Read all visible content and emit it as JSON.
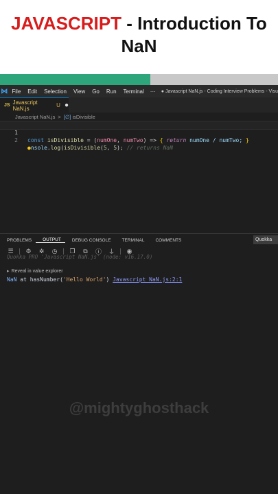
{
  "header": {
    "title_accent": "JAVASCRIPT",
    "title_rest": " - Introduction To",
    "title_line2": "NaN"
  },
  "progress": {
    "fraction": 0.54,
    "fill_color": "#2ea57a",
    "track_color": "#c8c8c8"
  },
  "menubar": {
    "logo_icon": "vscode-icon",
    "items": [
      "File",
      "Edit",
      "Selection",
      "View",
      "Go",
      "Run",
      "Terminal"
    ],
    "more": "···",
    "window_title": "● Javascript NaN.js - Coding Interview Problems - Visu"
  },
  "tab": {
    "icon": "JS",
    "filename": "Javascript NaN.js",
    "modified": "U",
    "dirty": "●"
  },
  "breadcrumb": {
    "icon": "JS",
    "file": "Javascript NaN.js",
    "separator": ">",
    "symbol_icon": "[∅]",
    "symbol": "isDivisible"
  },
  "editor": {
    "line1": {
      "num": "1",
      "t1": "const",
      "t2": " ",
      "t3": "isDivisible",
      "t4": " = (",
      "t5": "numOne",
      "t6": ", ",
      "t7": "numTwo",
      "t8": ") => ",
      "t9": "{",
      "t10": " ",
      "t11": "return",
      "t12": " numOne / numTwo; ",
      "t13": "}"
    },
    "line2": {
      "num": "2",
      "bulb": "●",
      "t1": "nsole",
      "t2": ".",
      "t3": "log",
      "t4": "(",
      "t5": "isDivisible",
      "t6": "(",
      "t7": "5",
      "t8": ", ",
      "t9": "5",
      "t10": "); ",
      "t11": "// returns NaN"
    }
  },
  "panel": {
    "tabs": [
      "PROBLEMS",
      "OUTPUT",
      "DEBUG CONSOLE",
      "TERMINAL",
      "COMMENTS"
    ],
    "active_tab": "OUTPUT",
    "selector": "Quokka",
    "toolbar_icons": [
      "list-icon",
      "gear-icon",
      "bug-icon",
      "clock-icon",
      "copy-icon",
      "copy-icon",
      "info-icon",
      "filter-icon",
      "record-icon"
    ],
    "quokka_line": "Quokka PRO 'Javascript NaN.js' (node: v16.17.0)",
    "reveal_label": "Reveal in value explorer",
    "result": {
      "value": "NaN",
      "at": " at ",
      "fn": "hasNumber",
      "open": "(",
      "arg": "'Hello World'",
      "close": ")",
      "gap": " ",
      "link": "Javascript NaN.js:2:1"
    }
  },
  "watermark": "@mightyghosthack"
}
